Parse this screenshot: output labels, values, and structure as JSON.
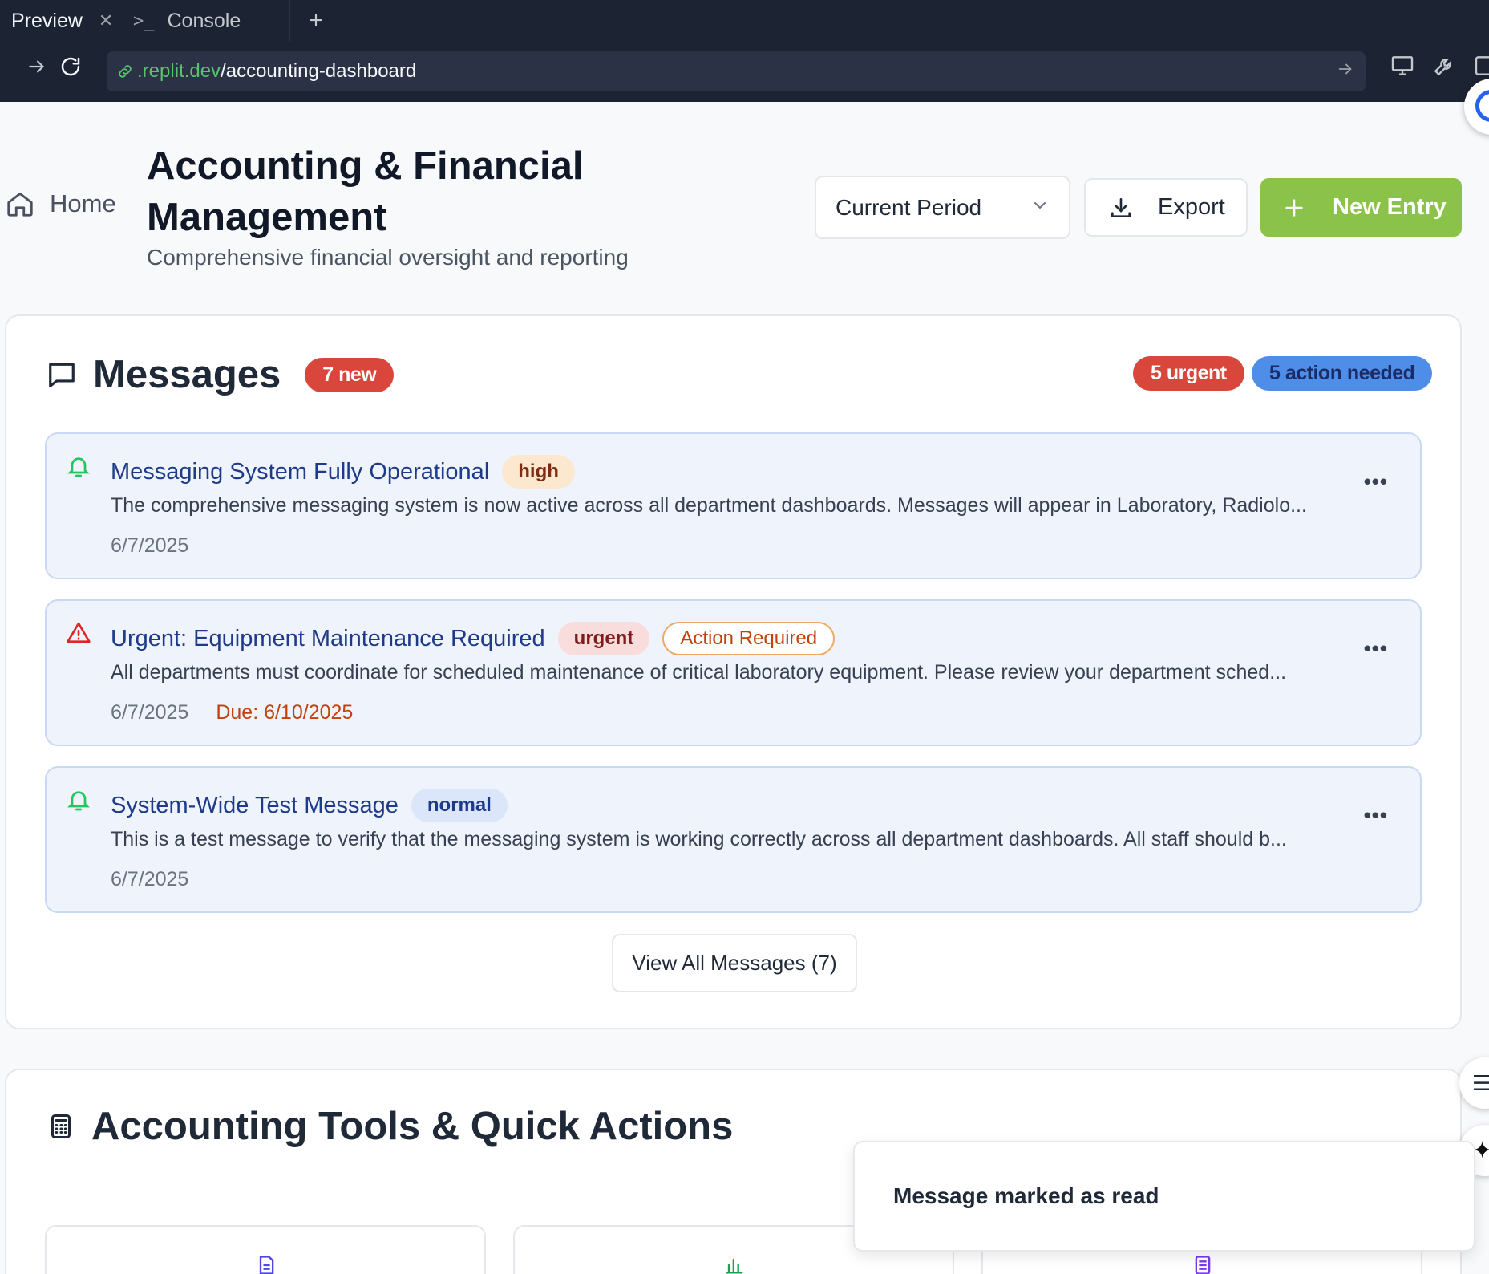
{
  "browser": {
    "tabs": [
      {
        "label": "Preview",
        "active": true
      },
      {
        "label": "Console",
        "active": false
      }
    ],
    "url_host": ".replit.dev",
    "url_path": "/accounting-dashboard"
  },
  "header": {
    "home_label": "Home",
    "title": "Accounting & Financial Management",
    "subtitle": "Comprehensive financial oversight and reporting",
    "period_select": "Current Period",
    "export_label": "Export",
    "new_entry_label": "New Entry"
  },
  "messages": {
    "title": "Messages",
    "new_badge": "7 new",
    "urgent_badge": "5 urgent",
    "action_badge": "5 action needed",
    "items": [
      {
        "icon": "bell-icon",
        "title": "Messaging System Fully Operational",
        "priority": "high",
        "body": "The comprehensive messaging system is now active across all department dashboards. Messages will appear in Laboratory, Radiolo...",
        "date": "6/7/2025"
      },
      {
        "icon": "warning-triangle-icon",
        "title": "Urgent: Equipment Maintenance Required",
        "priority": "urgent",
        "action": "Action Required",
        "body": "All departments must coordinate for scheduled maintenance of critical laboratory equipment. Please review your department sched...",
        "date": "6/7/2025",
        "due": "Due: 6/10/2025"
      },
      {
        "icon": "bell-icon",
        "title": "System-Wide Test Message",
        "priority": "normal",
        "body": "This is a test message to verify that the messaging system is working correctly across all department dashboards. All staff should b...",
        "date": "6/7/2025"
      }
    ],
    "view_all_label": "View All Messages (7)"
  },
  "tools": {
    "title": "Accounting Tools & Quick Actions"
  },
  "toast": {
    "text": "Message marked as read"
  },
  "colors": {
    "accent_green": "#8bc34a",
    "urgent_red": "#d9463c",
    "action_blue": "#4f8ee8",
    "message_bg": "#eef3fc"
  }
}
